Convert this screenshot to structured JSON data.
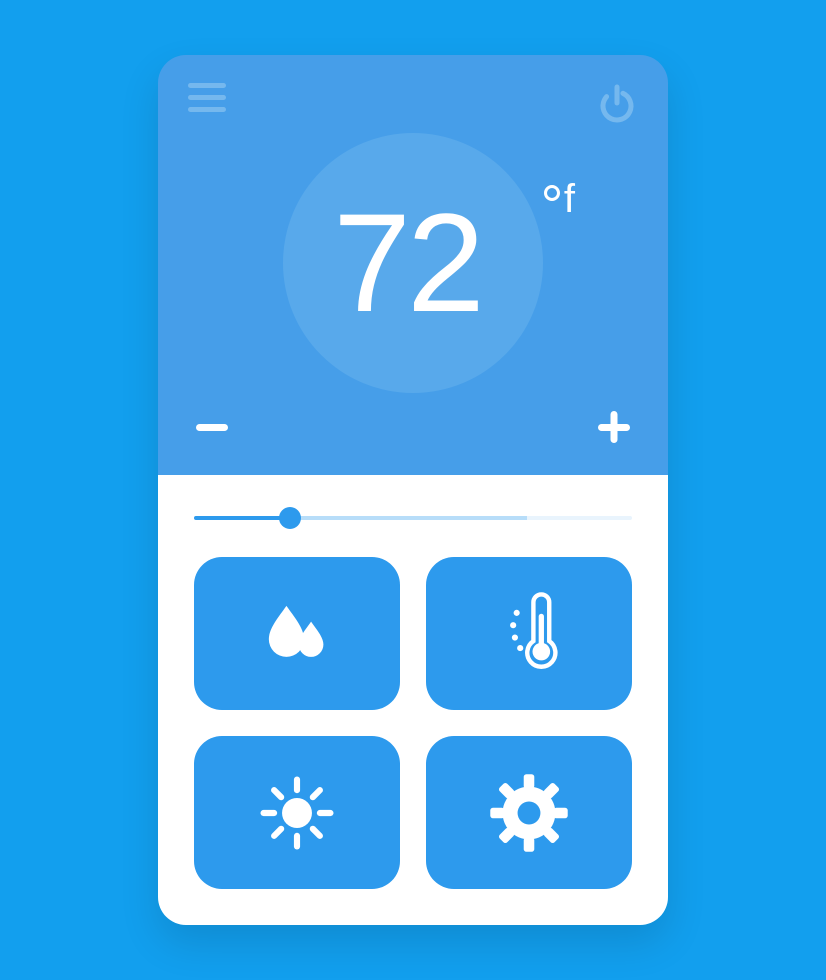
{
  "colors": {
    "page_bg": "#129fee",
    "panel_top": "#469ee9",
    "temp_circle": "#58a9eb",
    "icon_muted": "#75b8ee",
    "accent": "#2d9aed",
    "white": "#ffffff",
    "slider_mid": "#b7ddf9",
    "slider_end": "#e9f4fd"
  },
  "temperature": {
    "value": "72",
    "unit": "f"
  },
  "controls": {
    "menu": "menu",
    "power": "power",
    "decrease": "−",
    "increase": "+"
  },
  "slider": {
    "fill_a_pct": 22,
    "fill_b_pct": 54,
    "fill_c_pct": 24,
    "thumb_pct": 22
  },
  "tiles": [
    {
      "id": "humidity",
      "icon": "droplets-icon"
    },
    {
      "id": "temperature",
      "icon": "thermometer-icon"
    },
    {
      "id": "weather",
      "icon": "sun-icon"
    },
    {
      "id": "settings",
      "icon": "gear-icon"
    }
  ]
}
